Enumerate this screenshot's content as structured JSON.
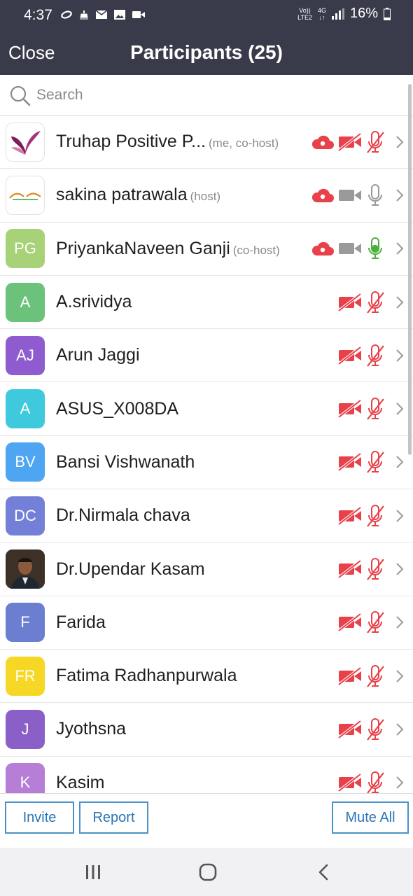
{
  "status_bar": {
    "time": "4:37",
    "volte_line1": "Vo))",
    "volte_line2": "LTE2",
    "network_line1": "4G",
    "network_line2": "↓↑",
    "battery": "16%"
  },
  "header": {
    "close_label": "Close",
    "title": "Participants (25)"
  },
  "search": {
    "placeholder": "Search"
  },
  "participants": [
    {
      "name": "Truhap Positive P...",
      "role": "(me, co-host)",
      "avatar_type": "logo-butterfly",
      "cloud": true,
      "video": "off-red",
      "mic": "off-red"
    },
    {
      "name": "sakina patrawala",
      "role": "(host)",
      "avatar_type": "logo-wellness",
      "cloud": true,
      "video": "on-gray",
      "mic": "on-gray"
    },
    {
      "name": "PriyankaNaveen Ganji",
      "role": "(co-host)",
      "initials": "PG",
      "color": "#a8d278",
      "cloud": true,
      "video": "on-gray",
      "mic": "on-green"
    },
    {
      "name": "A.srividya",
      "role": "",
      "initials": "A",
      "color": "#6cc27a",
      "cloud": false,
      "video": "off-red",
      "mic": "off-red"
    },
    {
      "name": "Arun Jaggi",
      "role": "",
      "initials": "AJ",
      "color": "#8e5ccf",
      "cloud": false,
      "video": "off-red",
      "mic": "off-red"
    },
    {
      "name": "ASUS_X008DA",
      "role": "",
      "initials": "A",
      "color": "#3ec9dc",
      "cloud": false,
      "video": "off-red",
      "mic": "off-red"
    },
    {
      "name": "Bansi Vishwanath",
      "role": "",
      "initials": "BV",
      "color": "#4ea5f2",
      "cloud": false,
      "video": "off-red",
      "mic": "off-red"
    },
    {
      "name": "Dr.Nirmala chava",
      "role": "",
      "initials": "DC",
      "color": "#7480d8",
      "cloud": false,
      "video": "off-red",
      "mic": "off-red"
    },
    {
      "name": "Dr.Upendar Kasam",
      "role": "",
      "avatar_type": "photo",
      "cloud": false,
      "video": "off-red",
      "mic": "off-red"
    },
    {
      "name": "Farida",
      "role": "",
      "initials": "F",
      "color": "#6b7ed0",
      "cloud": false,
      "video": "off-red",
      "mic": "off-red"
    },
    {
      "name": "Fatima Radhanpurwala",
      "role": "",
      "initials": "FR",
      "color": "#f6d726",
      "cloud": false,
      "video": "off-red",
      "mic": "off-red"
    },
    {
      "name": "Jyothsna",
      "role": "",
      "initials": "J",
      "color": "#8a5fc8",
      "cloud": false,
      "video": "off-red",
      "mic": "off-red"
    },
    {
      "name": "Kasim",
      "role": "",
      "initials": "K",
      "color": "#b67ed6",
      "cloud": false,
      "video": "off-red",
      "mic": "off-red"
    }
  ],
  "footer": {
    "invite_label": "Invite",
    "report_label": "Report",
    "mute_all_label": "Mute All"
  },
  "colors": {
    "header_bg": "#3a3b4a",
    "muted_red": "#e8414a",
    "active_gray": "#9a9a9a",
    "active_green": "#4caf3c",
    "button_blue": "#2a74b6"
  },
  "icons": {
    "cloud": "cloud-recording-icon",
    "video": "video-camera-icon",
    "mic": "microphone-icon",
    "chevron": "chevron-right-icon"
  }
}
